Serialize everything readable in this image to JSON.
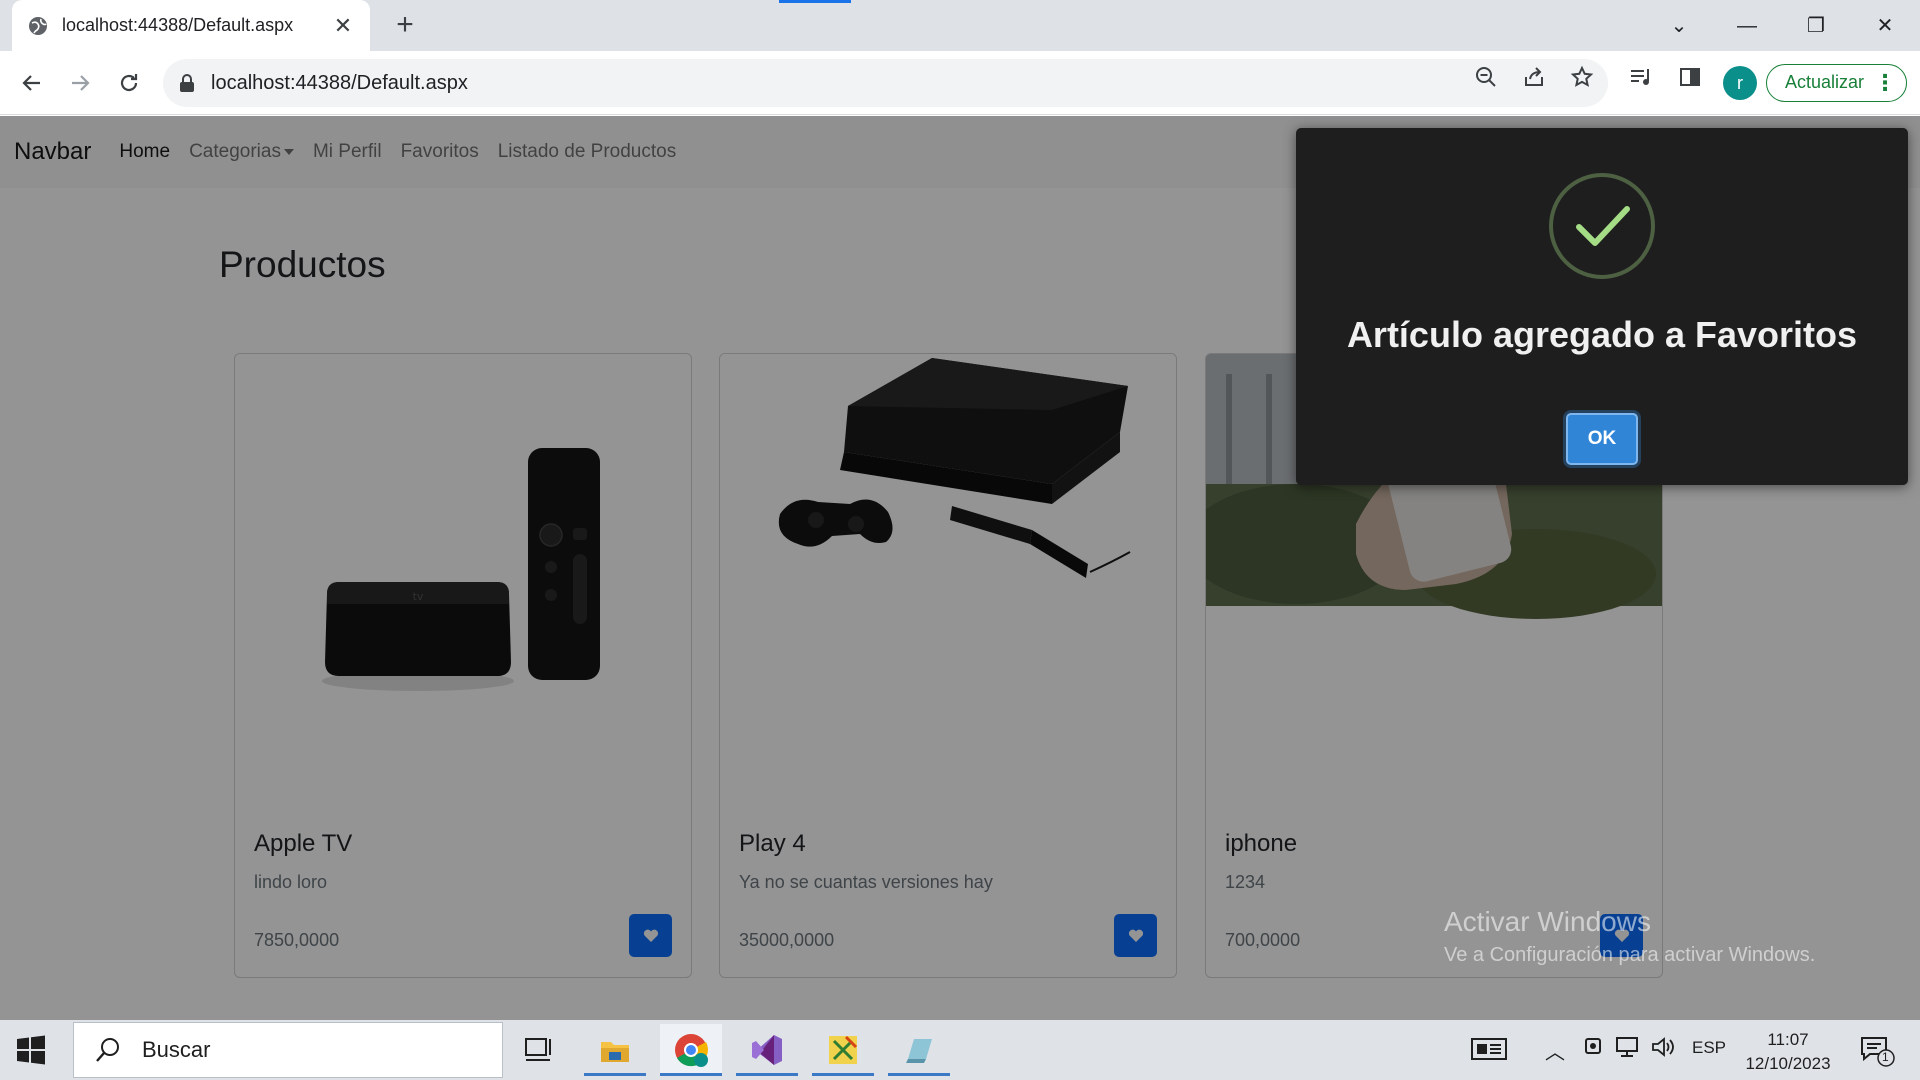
{
  "browser": {
    "tab_title": "localhost:44388/Default.aspx",
    "url_host": "localhost",
    "url_rest": ":44388/Default.aspx",
    "profile_initial": "r",
    "update_label": "Actualizar"
  },
  "navbar": {
    "brand": "Navbar",
    "links": [
      {
        "label": "Home",
        "active": true
      },
      {
        "label": "Categorias",
        "dropdown": true
      },
      {
        "label": "Mi Perfil"
      },
      {
        "label": "Favoritos"
      },
      {
        "label": "Listado de Productos"
      }
    ]
  },
  "main": {
    "title": "Productos",
    "products": [
      {
        "name": "Apple TV",
        "description": "lindo loro",
        "price": "7850,0000"
      },
      {
        "name": "Play 4",
        "description": "Ya no se cuantas versiones hay",
        "price": "35000,0000"
      },
      {
        "name": "iphone",
        "description": "1234",
        "price": "700,0000"
      }
    ]
  },
  "alert": {
    "title": "Artículo agregado a Favoritos",
    "ok_label": "OK",
    "icon": "success-check-icon",
    "colors": {
      "background": "#1e1e1e",
      "button": "#3085d6",
      "check": "#a5dc86"
    }
  },
  "watermark": {
    "line1": "Activar Windows",
    "line2": "Ve a Configuración para activar Windows."
  },
  "taskbar": {
    "search_placeholder": "Buscar",
    "language": "ESP",
    "time": "11:07",
    "date": "12/10/2023",
    "notification_count": "1"
  },
  "colors": {
    "primary": "#0d6efd",
    "chrome_tab_bg": "#dee1e6",
    "update_green": "#188038"
  }
}
